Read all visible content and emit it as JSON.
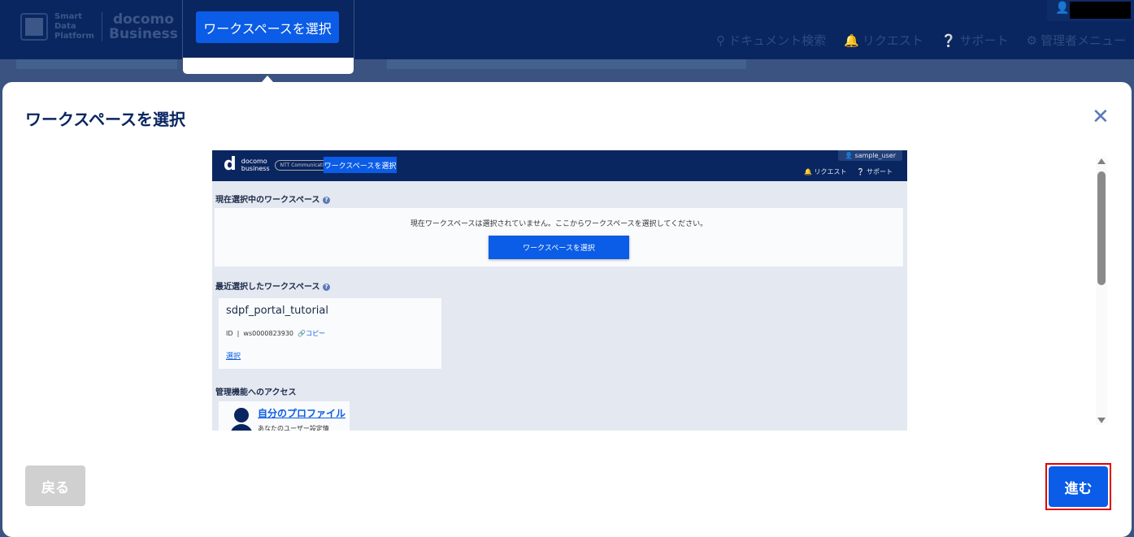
{
  "header": {
    "logo_sdp": "Smart Data Platform",
    "logo_docomo": "docomo",
    "logo_business": "Business",
    "workspace_button": "ワークスペースを選択",
    "nav": [
      {
        "icon": "search-icon",
        "label": "ドキュメント検索"
      },
      {
        "icon": "bell-icon",
        "label": "リクエスト"
      },
      {
        "icon": "help-icon",
        "label": "サポート"
      },
      {
        "icon": "gear-icon",
        "label": "管理者メニュー"
      }
    ]
  },
  "modal": {
    "title": "ワークスペースを選択",
    "back_label": "戻る",
    "next_label": "進む",
    "screenshot": {
      "logo_docomo": "docomo",
      "logo_business": "business",
      "logo_ntt": "NTT Communications",
      "workspace_button": "ワークスペースを選択",
      "user": "sample_user",
      "nav_request": "リクエスト",
      "nav_support": "サポート",
      "current_heading": "現在選択中のワークスペース",
      "current_message": "現在ワークスペースは選択されていません。ここからワークスペースを選択してください。",
      "select_button": "ワークスペースを選択",
      "recent_heading": "最近選択したワークスペース",
      "ws_name": "sdpf_portal_tutorial",
      "id_label": "ID",
      "id_value": "ws0000823930",
      "copy_label": "コピー",
      "select_link": "選択",
      "admin_heading": "管理機能へのアクセス",
      "profile_link": "自分のプロファイル",
      "profile_desc": "あなたのユーザー設定情"
    }
  },
  "colors": {
    "navy": "#0a2660",
    "primary": "#0b5ce6",
    "highlight": "#e00000"
  }
}
